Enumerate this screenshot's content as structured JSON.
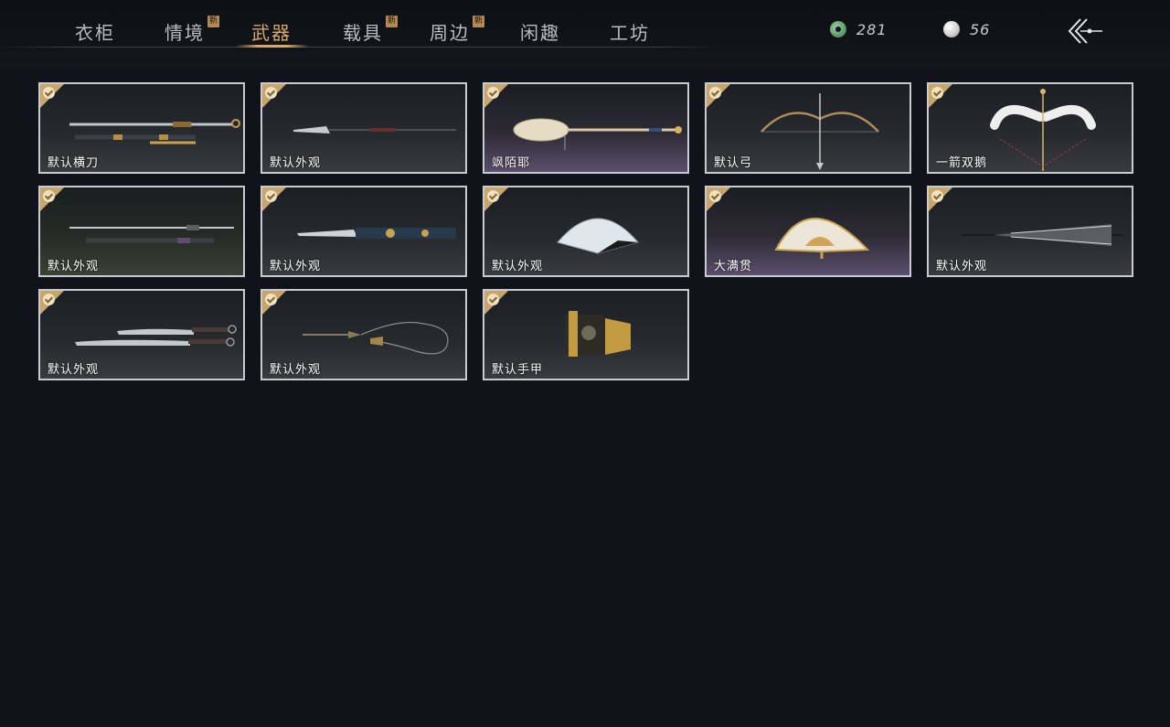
{
  "tabs": [
    {
      "label": "衣柜",
      "new": false,
      "active": false
    },
    {
      "label": "情境",
      "new": true,
      "active": false
    },
    {
      "label": "武器",
      "new": false,
      "active": true
    },
    {
      "label": "载具",
      "new": true,
      "active": false
    },
    {
      "label": "周边",
      "new": true,
      "active": false
    },
    {
      "label": "闲趣",
      "new": false,
      "active": false
    },
    {
      "label": "工坊",
      "new": false,
      "active": false
    }
  ],
  "new_badge_text": "新",
  "currency": {
    "jade": {
      "icon": "jade-coin-icon",
      "value": "281"
    },
    "pearl": {
      "icon": "pearl-icon",
      "value": "56"
    }
  },
  "back_icon": "back-arrow-icon",
  "items": [
    {
      "label": "默认横刀",
      "owned": true,
      "art": "saber"
    },
    {
      "label": "默认外观",
      "owned": true,
      "art": "spear"
    },
    {
      "label": "飒陌耶",
      "owned": true,
      "art": "staff"
    },
    {
      "label": "默认弓",
      "owned": true,
      "art": "bow"
    },
    {
      "label": "一箭双鹅",
      "owned": true,
      "art": "bow-swan"
    },
    {
      "label": "默认外观",
      "owned": true,
      "art": "sword"
    },
    {
      "label": "默认外观",
      "owned": true,
      "art": "long-blade"
    },
    {
      "label": "默认外观",
      "owned": true,
      "art": "fan"
    },
    {
      "label": "大满贯",
      "owned": true,
      "art": "fan-gold"
    },
    {
      "label": "默认外观",
      "owned": true,
      "art": "umbrella"
    },
    {
      "label": "默认外观",
      "owned": true,
      "art": "twin-blades"
    },
    {
      "label": "默认外观",
      "owned": true,
      "art": "rope-dart"
    },
    {
      "label": "默认手甲",
      "owned": true,
      "art": "gauntlet"
    }
  ],
  "colors": {
    "accent": "#d8a864",
    "check": "#c8a56a",
    "background": "#10141a"
  }
}
